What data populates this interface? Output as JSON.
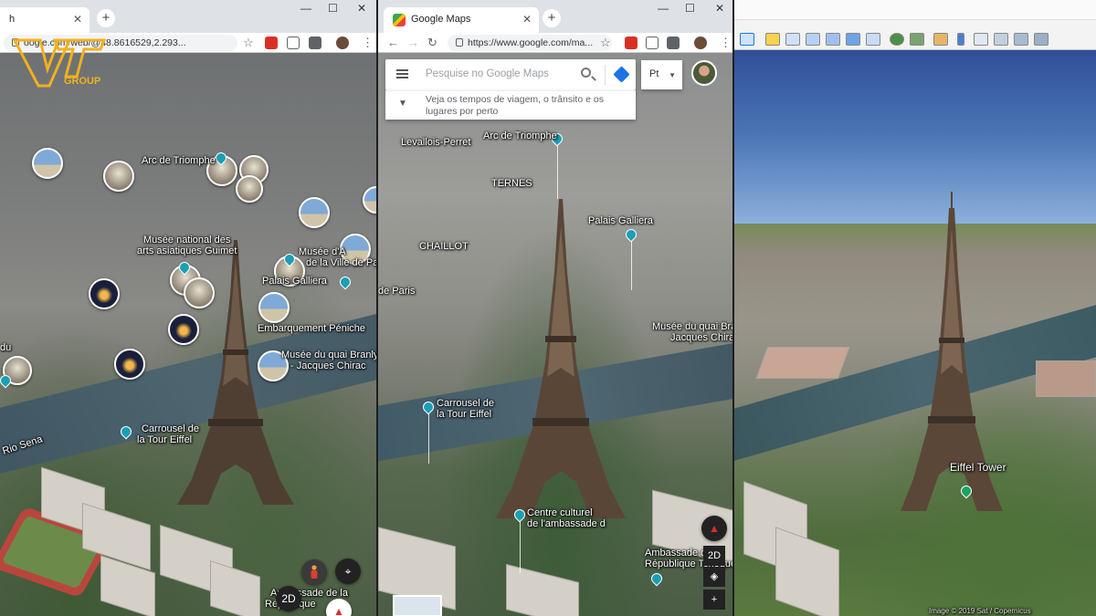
{
  "panel1": {
    "tab_title": "h",
    "url": "oogle.com/web/@48.8616529,2.293...",
    "logo_text": "GROUP",
    "labels": {
      "arc": "Arc de Triomphe",
      "guimet1": "Musée national des",
      "guimet2": "arts asiatiques Guimet",
      "art1": "Musée d'A",
      "art2": "de la Ville de Par",
      "palais": "Palais Galliera",
      "embarquement": "Embarquement Péniche",
      "branly1": "Musée du quai Branly",
      "branly2": "- Jacques Chirac",
      "carrousel1": "Carrousel de",
      "carrousel2": "la Tour Eiffel",
      "rio": "Rio Sena",
      "ambassade1": "Ambassade de la",
      "ambassade2": "République",
      "du": "du"
    },
    "controls": {
      "mode": "2D"
    }
  },
  "panel2": {
    "tab_title": "Google Maps",
    "url": "https://www.google.com/ma...",
    "search_placeholder": "Pesquise no Google Maps",
    "suggestion": "Veja os tempos de viagem, o trânsito e os lugares por perto",
    "language": "Pt",
    "labels": {
      "levallois": "Levallois-Perret",
      "arc": "Arc de Triomphe",
      "ternes": "TERNES",
      "palais": "Palais Galliera",
      "chaillot": "CHAILLOT",
      "parc": "de Paris",
      "branly1": "Musée du quai Branly",
      "branly2": "Jacques Chirac",
      "carrousel1": "Carrousel de",
      "carrousel2": "la Tour Eiffel",
      "centre1": "Centre culturel",
      "centre2": "de l'ambassade d",
      "ambassade1": "Ambassade de la",
      "ambassade2": "République Tchèque"
    },
    "controls": {
      "mode": "2D",
      "zoom_in": "+"
    }
  },
  "panel3": {
    "labels": {
      "eiffel": "Eiffel Tower",
      "credit": "Image © 2019 Sat / Copernicus"
    }
  },
  "window": {
    "minimize": "—",
    "restore": "☐",
    "close": "✕"
  }
}
